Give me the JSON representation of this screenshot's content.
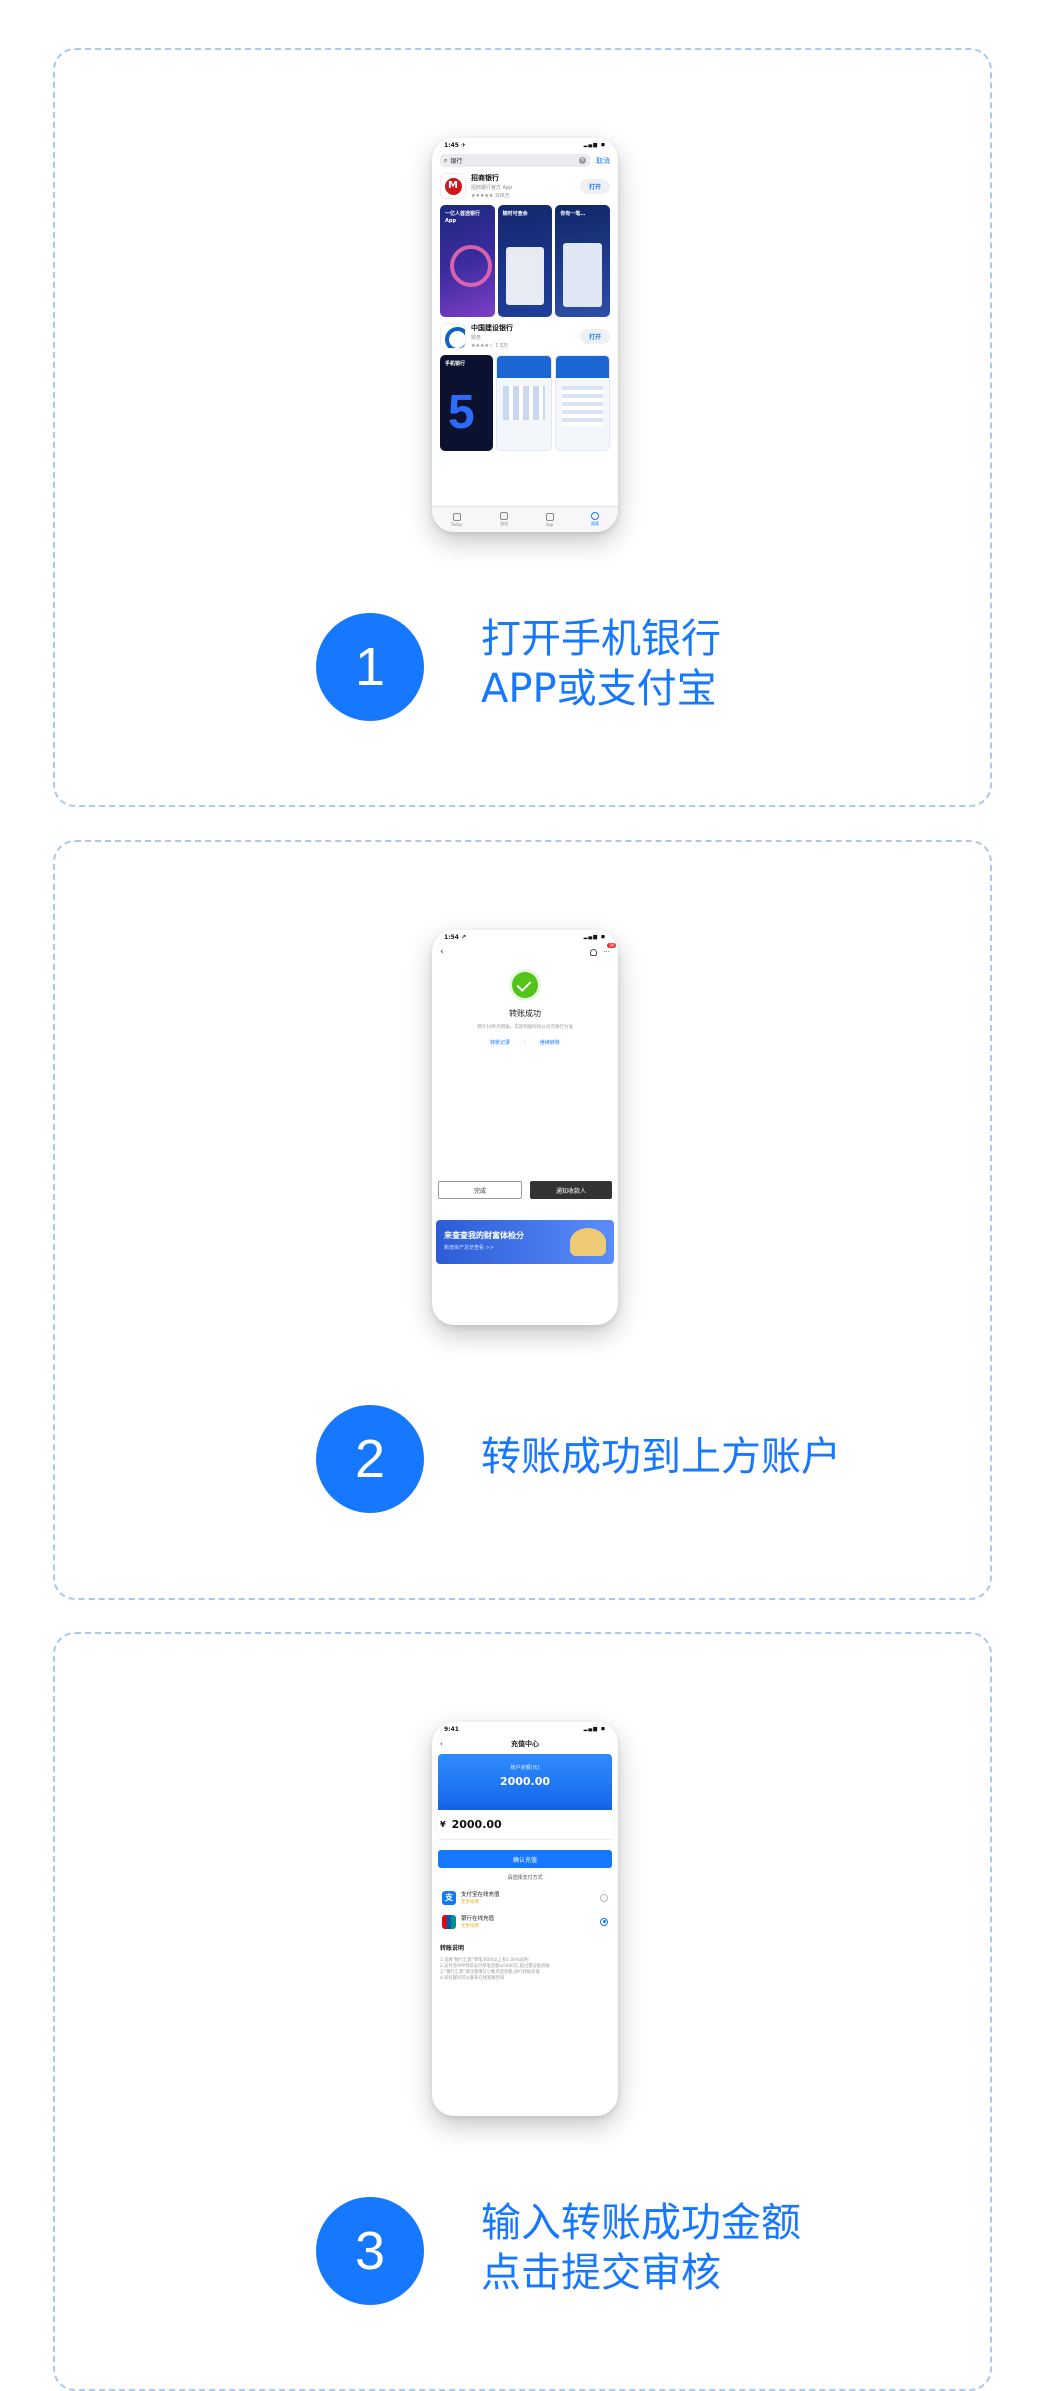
{
  "steps": [
    {
      "number": "1",
      "lines": [
        "打开手机银行",
        "APP或支付宝"
      ],
      "phone": {
        "time": "1:45 ✈",
        "signal": "▂▄▆ ◼",
        "search_text": "银行",
        "cancel": "取消",
        "apps": [
          {
            "name": "招商银行",
            "sub": "招商银行官方 App",
            "stars": "★★★★★ 206万",
            "open": "打开"
          },
          {
            "name": "中国建设银行",
            "sub": "财务",
            "stars": "★★★★☆ 7.3万",
            "open": "打开"
          }
        ],
        "shot_captions": [
          "一亿人首选银行App",
          "随时可查余",
          "你有一笔…"
        ],
        "ccb_shot_caption": "手机银行",
        "tabs": [
          "Today",
          "游戏",
          "App",
          "搜索"
        ]
      }
    },
    {
      "number": "2",
      "lines": [
        "转账成功到上方账户"
      ],
      "phone": {
        "time": "1:54 ↗",
        "signal": "▂▄▆ ◼",
        "back": "‹",
        "badge": "99",
        "title": "转账成功",
        "desc": "预计10秒内到账，实际到账时间以对方银行为准",
        "link_record": "转账记录",
        "link_sep": "|",
        "link_continue": "继续转账",
        "btn_done": "完成",
        "btn_notify": "通知收款人",
        "banner_title": "来查查我的财富体检分",
        "banner_sub": "新增资产总览查看 >>"
      }
    },
    {
      "number": "3",
      "lines": [
        "输入转账成功金额",
        "点击提交审核"
      ],
      "phone": {
        "time": "9:41",
        "signal": "▂▄▆ ◼",
        "back": "‹",
        "title": "充值中心",
        "balance_label": "账户余额(元)",
        "balance": "2000.00",
        "yen": "¥",
        "amount": "2000.00",
        "confirm": "确认充值",
        "hint": "请选择支付方式",
        "methods": [
          {
            "name": "支付宝在线充值",
            "sub": "无手续费"
          },
          {
            "name": "银行在线充值",
            "sub": "无手续费"
          }
        ],
        "notes_title": "转账说明",
        "notes": [
          "1.选择\"银行汇款\"单笔3000以上有1.00%返利",
          "2.支付宝APP目前支付单笔金额≤5000元,超过需分批转账",
          "3.\"银行汇款\"请注意填写小数点后金额,进行转账充值",
          "4.如有疑问可以联系在线客服咨询"
        ]
      }
    }
  ]
}
